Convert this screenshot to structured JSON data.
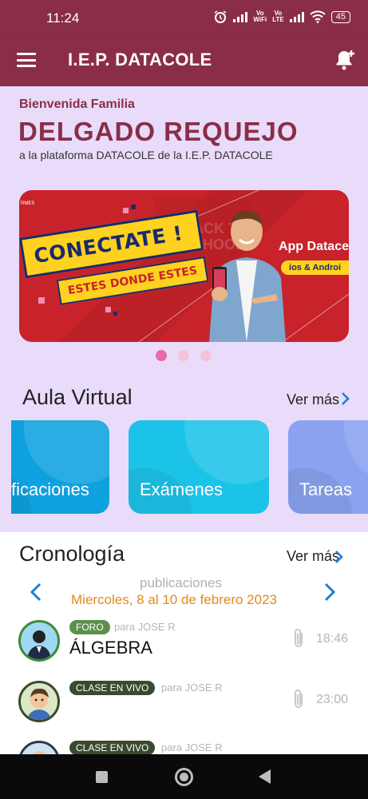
{
  "status": {
    "time": "11:24",
    "volte1": "Vo\nWiFi",
    "volte2": "Vo\nLTE",
    "battery": "45"
  },
  "app_bar": {
    "title": "I.E.P. DATACOLE"
  },
  "welcome": {
    "greeting": "Bienvenida Familia",
    "family_name": "DELGADO REQUEJO",
    "platform_text": "a la plataforma DATACOLE de la I.E.P. DATACOLE"
  },
  "banner": {
    "corner_text": "RMES",
    "cta": "CONECTATE !",
    "sub": "ESTES DONDE ESTES",
    "bg_word": "BACK TO SCHOOL",
    "app_title": "App Datace",
    "platforms": "ios & Androi",
    "slide_count": 3,
    "active_slide": 0
  },
  "aula_virtual": {
    "title": "Aula Virtual",
    "see_more": "Ver más",
    "cards": [
      {
        "label": "ficaciones",
        "color": "#0ea1df"
      },
      {
        "label": "Exámenes",
        "color": "#1cc3e8"
      },
      {
        "label": "Tareas",
        "color": "#8aa2f0"
      }
    ]
  },
  "cronologia": {
    "title": "Cronología",
    "see_more": "Ver más",
    "section_label": "publicaciones",
    "date_range": "Miercoles, 8 al 10 de febrero 2023",
    "posts": [
      {
        "badge": "FORO",
        "to": "para JOSE R",
        "title": "ÁLGEBRA",
        "time": "18:46"
      },
      {
        "badge": "CLASE EN VIVO",
        "to": "para JOSE R",
        "title": "",
        "time": "23:00"
      },
      {
        "badge": "CLASE EN VIVO",
        "to": "para JOSE R",
        "title": "",
        "time": ""
      }
    ]
  },
  "colors": {
    "brand": "#8a2e48",
    "accent_blue": "#1e7fd6",
    "date_orange": "#e28a1a",
    "background_lavender": "#e9dcfa"
  }
}
